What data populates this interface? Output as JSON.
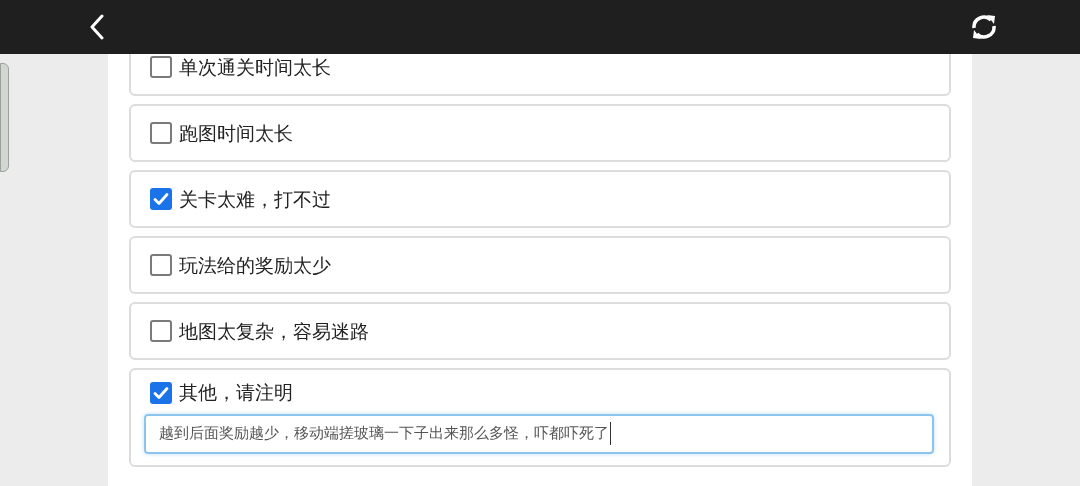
{
  "options": [
    {
      "label": "单次通关时间太长",
      "checked": false
    },
    {
      "label": "跑图时间太长",
      "checked": false
    },
    {
      "label": "关卡太难，打不过",
      "checked": true
    },
    {
      "label": "玩法给的奖励太少",
      "checked": false
    },
    {
      "label": "地图太复杂，容易迷路",
      "checked": false
    },
    {
      "label": "其他，请注明",
      "checked": true,
      "kind": "other",
      "input": {
        "value": "越到后面奖励越少，移动端搓玻璃一下子出来那么多怪，吓都吓死了"
      }
    }
  ]
}
